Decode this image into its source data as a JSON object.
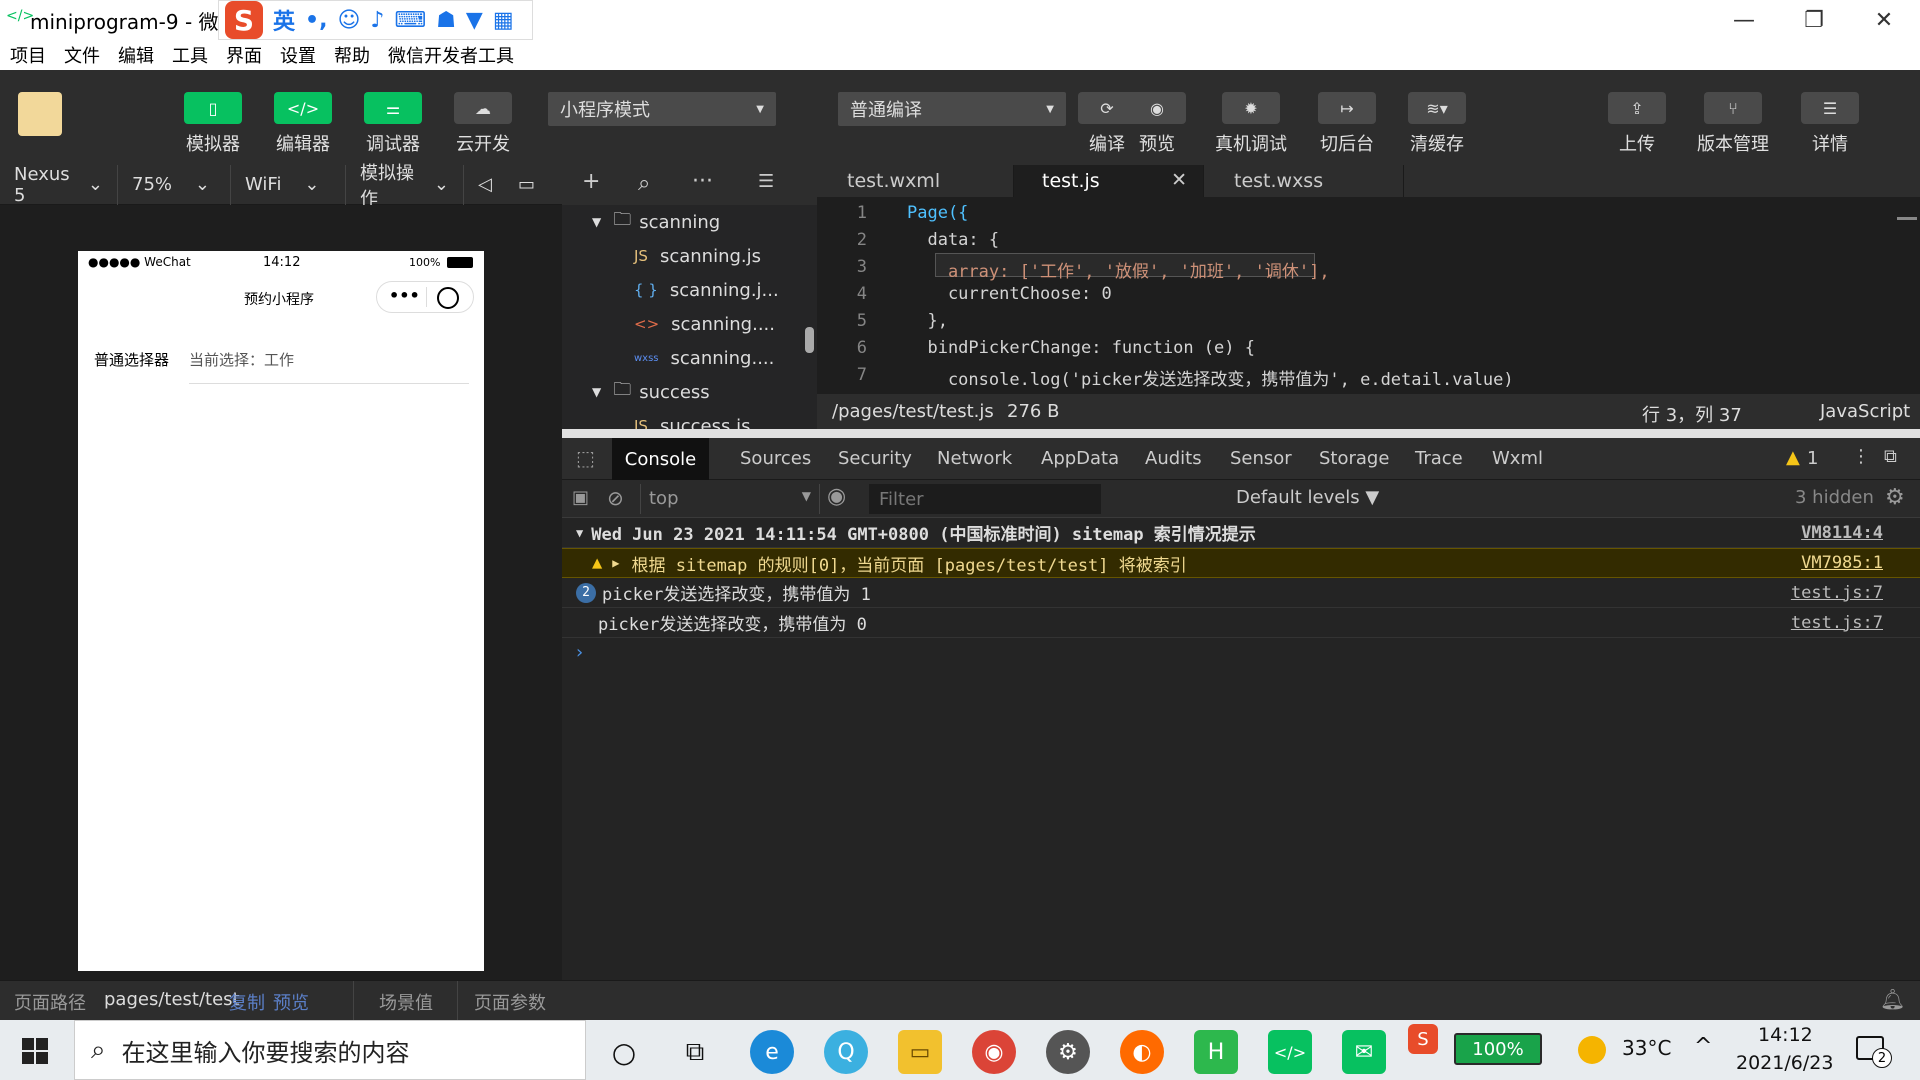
{
  "window": {
    "title": "miniprogram-9 - 微信开发者工具",
    "title_short": "miniprogram-9 - 微信"
  },
  "ime": {
    "lang": "英",
    "punct": "•,"
  },
  "menu": [
    "项目",
    "文件",
    "编辑",
    "工具",
    "界面",
    "设置",
    "帮助",
    "微信开发者工具"
  ],
  "toolbar": {
    "simulator": "模拟器",
    "editor": "编辑器",
    "debugger": "调试器",
    "cloud": "云开发",
    "mode": "小程序模式",
    "compile_mode": "普通编译",
    "compile": "编译",
    "preview": "预览",
    "remote_debug": "真机调试",
    "background": "切后台",
    "clear_cache": "清缓存",
    "upload": "上传",
    "version": "版本管理",
    "details": "详情"
  },
  "simbar": {
    "device": "Nexus 5",
    "zoom": "75%",
    "network": "WiFi",
    "ops": "模拟操作"
  },
  "phone": {
    "signal": "●●●●● WeChat",
    "time": "14:12",
    "battery": "100%",
    "nav_title": "预约小程序",
    "picker_label": "普通选择器",
    "current": "当前选择：工作"
  },
  "tree": [
    {
      "name": "scanning",
      "type": "folder"
    },
    {
      "name": "scanning.js",
      "type": "js"
    },
    {
      "name": "scanning.j...",
      "type": "json"
    },
    {
      "name": "scanning....",
      "type": "wxml"
    },
    {
      "name": "scanning....",
      "type": "wxss"
    },
    {
      "name": "success",
      "type": "folder"
    },
    {
      "name": "success.js",
      "type": "js"
    }
  ],
  "tabs": [
    "test.wxml",
    "test.js",
    "test.wxss"
  ],
  "code": [
    {
      "n": "1",
      "t": "Page({"
    },
    {
      "n": "2",
      "t": "  data: {"
    },
    {
      "n": "3",
      "t": "    array: ['工作', '放假', '加班', '调休'],"
    },
    {
      "n": "4",
      "t": "    currentChoose: 0"
    },
    {
      "n": "5",
      "t": "  },"
    },
    {
      "n": "6",
      "t": "  bindPickerChange: function (e) {"
    },
    {
      "n": "7",
      "t": "    console.log('picker发送选择改变，携带值为', e.detail.value)"
    }
  ],
  "status": {
    "path": "/pages/test/test.js",
    "size": "276 B",
    "pos": "行 3，列 37",
    "lang": "JavaScript"
  },
  "devtabs": [
    "Console",
    "Sources",
    "Security",
    "Network",
    "AppData",
    "Audits",
    "Sensor",
    "Storage",
    "Trace",
    "Wxml"
  ],
  "warn_count": "1",
  "filter": {
    "context": "top",
    "placeholder": "Filter",
    "levels": "Default levels ▼",
    "hidden": "3 hidden"
  },
  "console": [
    {
      "text": "Wed Jun 23 2021 14:11:54 GMT+0800 (中国标准时间) sitemap 索引情况提示",
      "src": "VM8114:4"
    },
    {
      "text": "根据 sitemap 的规则[0]，当前页面 [pages/test/test] 将被索引",
      "src": "VM7985:1"
    },
    {
      "count": "2",
      "text": "picker发送选择改变，携带值为 1",
      "src": "test.js:7"
    },
    {
      "text": "picker发送选择改变，携带值为 0",
      "src": "test.js:7"
    }
  ],
  "bottom": {
    "path_label": "页面路径",
    "path": "pages/test/test",
    "copy": "复制",
    "preview": "预览",
    "scene": "场景值",
    "params": "页面参数"
  },
  "taskbar": {
    "search": "在这里输入你要搜索的内容",
    "battery": "100%",
    "temp": "33°C",
    "time": "14:12",
    "date": "2021/6/23",
    "notif": "2"
  },
  "colors": {
    "accent": "#07c160",
    "warn": "#f5c518"
  }
}
